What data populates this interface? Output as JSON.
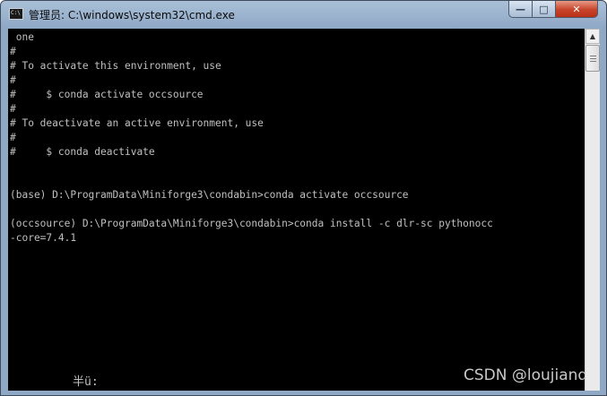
{
  "window": {
    "title": "管理员: C:\\windows\\system32\\cmd.exe",
    "app_icon_text": "C:\\",
    "buttons": {
      "minimize": "—",
      "maximize": "□",
      "close": "✕"
    }
  },
  "console": {
    "lines": [
      " one",
      "#",
      "# To activate this environment, use",
      "#",
      "#     $ conda activate occsource",
      "#",
      "# To deactivate an active environment, use",
      "#",
      "#     $ conda deactivate",
      "",
      "",
      "(base) D:\\ProgramData\\Miniforge3\\condabin>conda activate occsource",
      "",
      "(occsource) D:\\ProgramData\\Miniforge3\\condabin>conda install -c dlr-sc pythonocc",
      "-core=7.4.1"
    ],
    "ime_status": "半ü:"
  },
  "watermark": "CSDN @loujiand",
  "colors": {
    "console_bg": "#000000",
    "console_fg": "#c0c0c0",
    "close_button": "#c7432a"
  },
  "scrollbar": {
    "up_arrow": "▲"
  }
}
